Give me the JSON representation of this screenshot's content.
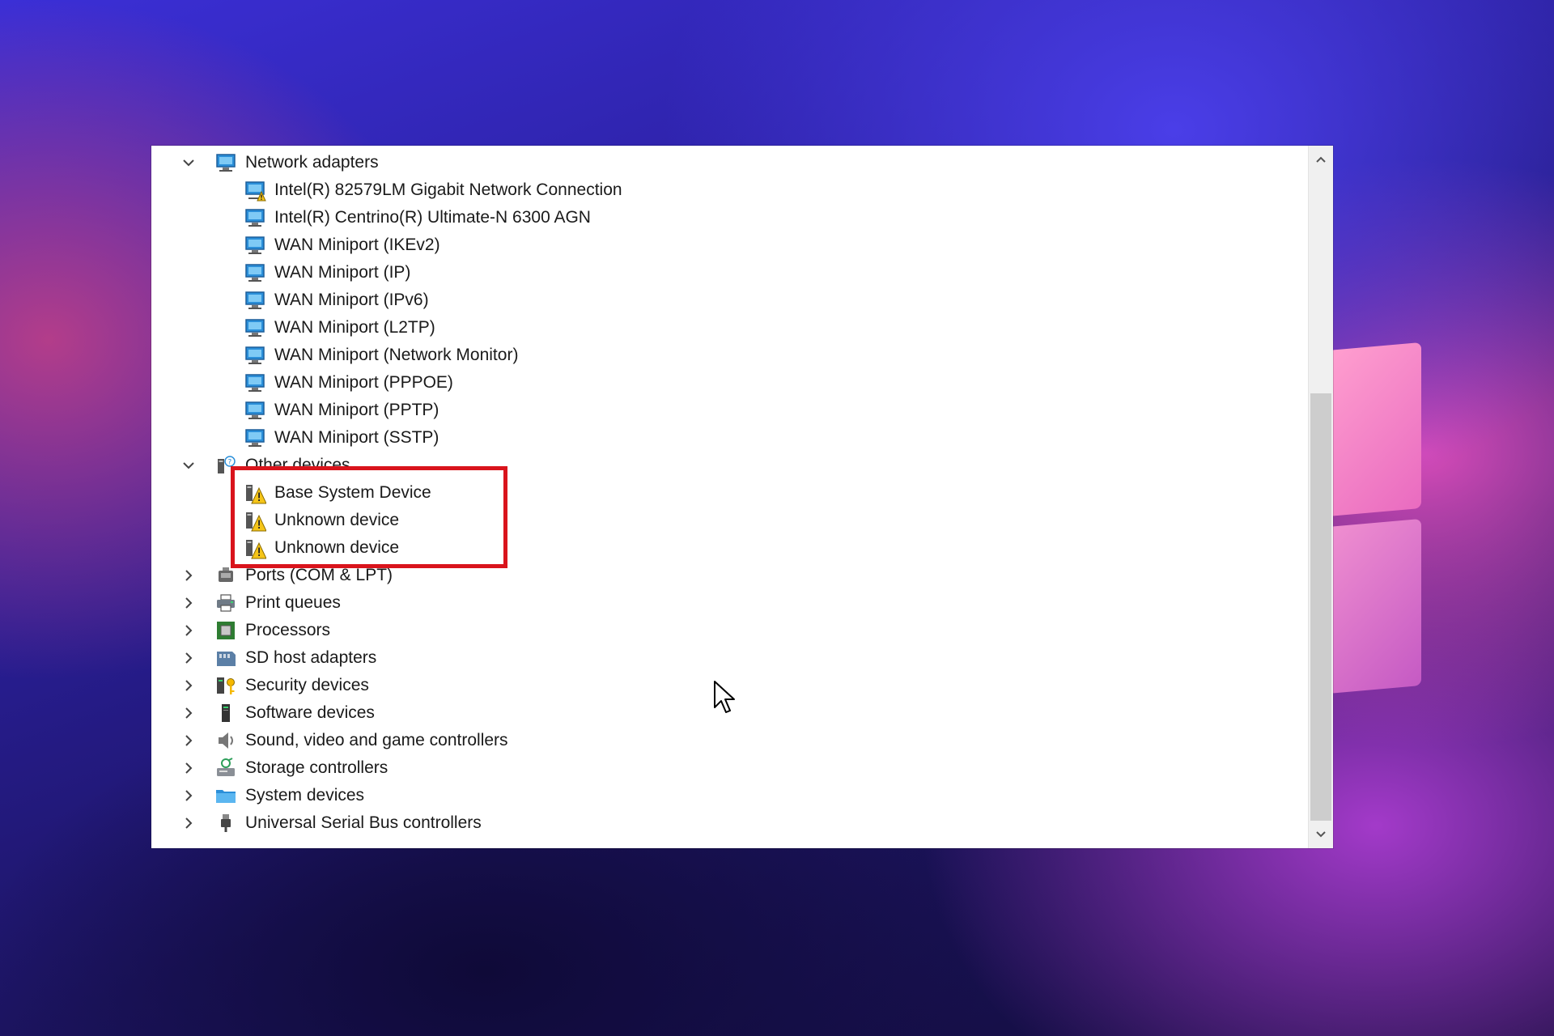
{
  "tree": {
    "network_adapters": {
      "label": "Network adapters",
      "icon": "network-adapter-icon",
      "expanded": true,
      "children": [
        {
          "label": "Intel(R) 82579LM Gigabit Network Connection",
          "icon": "network-adapter-warning-icon"
        },
        {
          "label": "Intel(R) Centrino(R) Ultimate-N 6300 AGN",
          "icon": "network-adapter-icon"
        },
        {
          "label": "WAN Miniport (IKEv2)",
          "icon": "network-adapter-icon"
        },
        {
          "label": "WAN Miniport (IP)",
          "icon": "network-adapter-icon"
        },
        {
          "label": "WAN Miniport (IPv6)",
          "icon": "network-adapter-icon"
        },
        {
          "label": "WAN Miniport (L2TP)",
          "icon": "network-adapter-icon"
        },
        {
          "label": "WAN Miniport (Network Monitor)",
          "icon": "network-adapter-icon"
        },
        {
          "label": "WAN Miniport (PPPOE)",
          "icon": "network-adapter-icon"
        },
        {
          "label": "WAN Miniport (PPTP)",
          "icon": "network-adapter-icon"
        },
        {
          "label": "WAN Miniport (SSTP)",
          "icon": "network-adapter-icon"
        }
      ]
    },
    "other_devices": {
      "label": "Other devices",
      "icon": "unknown-device-category-icon",
      "expanded": true,
      "children": [
        {
          "label": "Base System Device",
          "icon": "unknown-device-warning-icon"
        },
        {
          "label": "Unknown device",
          "icon": "unknown-device-warning-icon"
        },
        {
          "label": "Unknown device",
          "icon": "unknown-device-warning-icon"
        }
      ]
    },
    "collapsed_categories": [
      {
        "label": "Ports (COM & LPT)",
        "icon": "port-icon"
      },
      {
        "label": "Print queues",
        "icon": "printer-icon"
      },
      {
        "label": "Processors",
        "icon": "processor-icon"
      },
      {
        "label": "SD host adapters",
        "icon": "sd-card-icon"
      },
      {
        "label": "Security devices",
        "icon": "security-key-icon"
      },
      {
        "label": "Software devices",
        "icon": "software-device-icon"
      },
      {
        "label": "Sound, video and game controllers",
        "icon": "speaker-icon"
      },
      {
        "label": "Storage controllers",
        "icon": "storage-controller-icon"
      },
      {
        "label": "System devices",
        "icon": "system-folder-icon"
      },
      {
        "label": "Universal Serial Bus controllers",
        "icon": "usb-plug-icon"
      }
    ]
  },
  "colors": {
    "highlight": "#d9141c",
    "warning": "#f5c518",
    "monitor_blue": "#2b8fd9"
  }
}
